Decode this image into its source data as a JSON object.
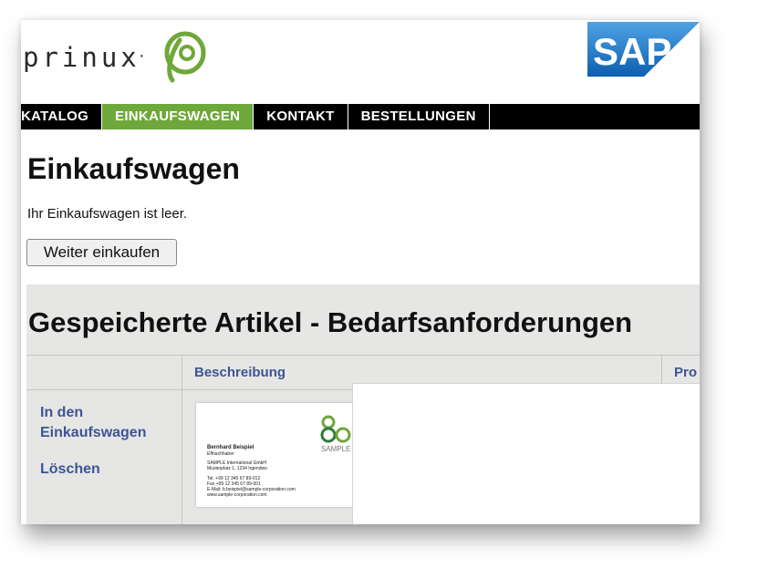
{
  "header": {
    "logo_text": "prinux",
    "logo_trademark": "·",
    "sap_logo_text": "SAP"
  },
  "nav": {
    "items": [
      {
        "label": "KATALOG"
      },
      {
        "label": "EINKAUFSWAGEN"
      },
      {
        "label": "KONTAKT"
      },
      {
        "label": "BESTELLUNGEN"
      }
    ],
    "active": "EINKAUFSWAGEN"
  },
  "cart": {
    "title": "Einkaufswagen",
    "empty_message": "Ihr Einkaufswagen ist leer.",
    "continue_button": "Weiter einkaufen"
  },
  "saved": {
    "title": "Gespeicherte Artikel - Bedarfsanforderungen",
    "columns": [
      "",
      "Beschreibung",
      "Pro"
    ],
    "row": {
      "actions": [
        "In den Einkaufswagen",
        "Löschen"
      ],
      "card": {
        "name": "Bernhard Beispiel",
        "role": "Effnachhaber",
        "company": "SAMPLE International GmbH",
        "address": "Musterplatz 1, 1234 Irgendwo",
        "phone": "Tel. +99 12 345 67 89-012",
        "fax": "Fax +99 12 345 67 89-001",
        "email": "E-Mail: b.beispiel@sample-corporation.com",
        "web": "www.sample-corporation.com",
        "brand": "SAMPLE"
      }
    }
  },
  "colors": {
    "accent_green": "#6fa83a",
    "link_blue": "#3d5597",
    "nav_bg": "#000000",
    "section_bg": "#e6e6e4",
    "sap_blue": "#1a74c4"
  }
}
